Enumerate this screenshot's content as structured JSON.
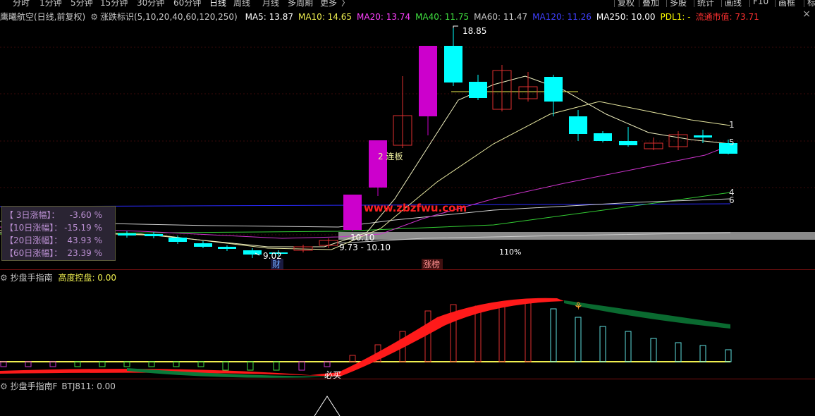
{
  "menu": {
    "items": [
      "分时",
      "1分钟",
      "5分钟",
      "15分钟",
      "30分钟",
      "60分钟",
      "日线",
      "周线",
      "月线",
      "多周期",
      "更多"
    ],
    "active_index": 6,
    "more_arrow": "〉",
    "right_buttons": [
      "复权",
      "叠加",
      "多股",
      "统计",
      "画线",
      "F10",
      "画框",
      "标"
    ]
  },
  "header": {
    "stock_name": "鹰曦航空(日线,前复权)",
    "indicator_icon": "gear-icon",
    "indicator_label": "涨跌标识(5,10,20,40,60,120,250)",
    "close_symbol": "×",
    "ma_values": [
      {
        "text": "MA5: 13.87",
        "color": "#ffffff"
      },
      {
        "text": "MA10: 14.65",
        "color": "#f0f050"
      },
      {
        "text": "MA20: 13.74",
        "color": "#ff40ff"
      },
      {
        "text": "MA40: 11.75",
        "color": "#40e040"
      },
      {
        "text": "MA60: 11.47",
        "color": "#c8c8c8"
      },
      {
        "text": "MA120: 11.26",
        "color": "#4040ff"
      },
      {
        "text": "MA250: 10.00",
        "color": "#ffffff"
      },
      {
        "text": "PDL1: -",
        "color": "#ffff00"
      },
      {
        "text": "流通市值: 73.71",
        "color": "#ff3030"
      }
    ]
  },
  "main_chart": {
    "labels": {
      "high_price": "18.85",
      "low_price": "9.02",
      "price_10_10": "10.10",
      "range": "9.73 - 10.10",
      "streak": "2 连板",
      "pct": "110%",
      "cai_tag": "财",
      "limit_tag": "涨榜",
      "watermark": "www.zbzfwu.com",
      "line_ids": [
        "1",
        "5",
        "4",
        "6"
      ]
    },
    "colors": {
      "up": "#e03030",
      "down": "#00ffff",
      "limit_up": "#cc00cc",
      "ma5": "#ffffff",
      "ma10": "#e8e8a0",
      "ma20": "#cc33cc",
      "ma40": "#33cc33",
      "ma120": "#2a2aff",
      "ma250": "#d0d0d0"
    }
  },
  "stats": {
    "rows": [
      {
        "label": "【 3日涨幅】：",
        "value": "-3.60 %"
      },
      {
        "label": "【10日涨幅】：",
        "value": "-15.19 %"
      },
      {
        "label": "【20日涨幅】：",
        "value": "43.93 %"
      },
      {
        "label": "【60日涨幅】：",
        "value": "23.39 %"
      }
    ]
  },
  "panel2": {
    "name": "抄盘手指南",
    "param": "高度控盘: 0.00",
    "buy_label": "必买"
  },
  "panel3": {
    "name": "抄盘手指南F",
    "param": "BTJ811: 0.00"
  }
}
